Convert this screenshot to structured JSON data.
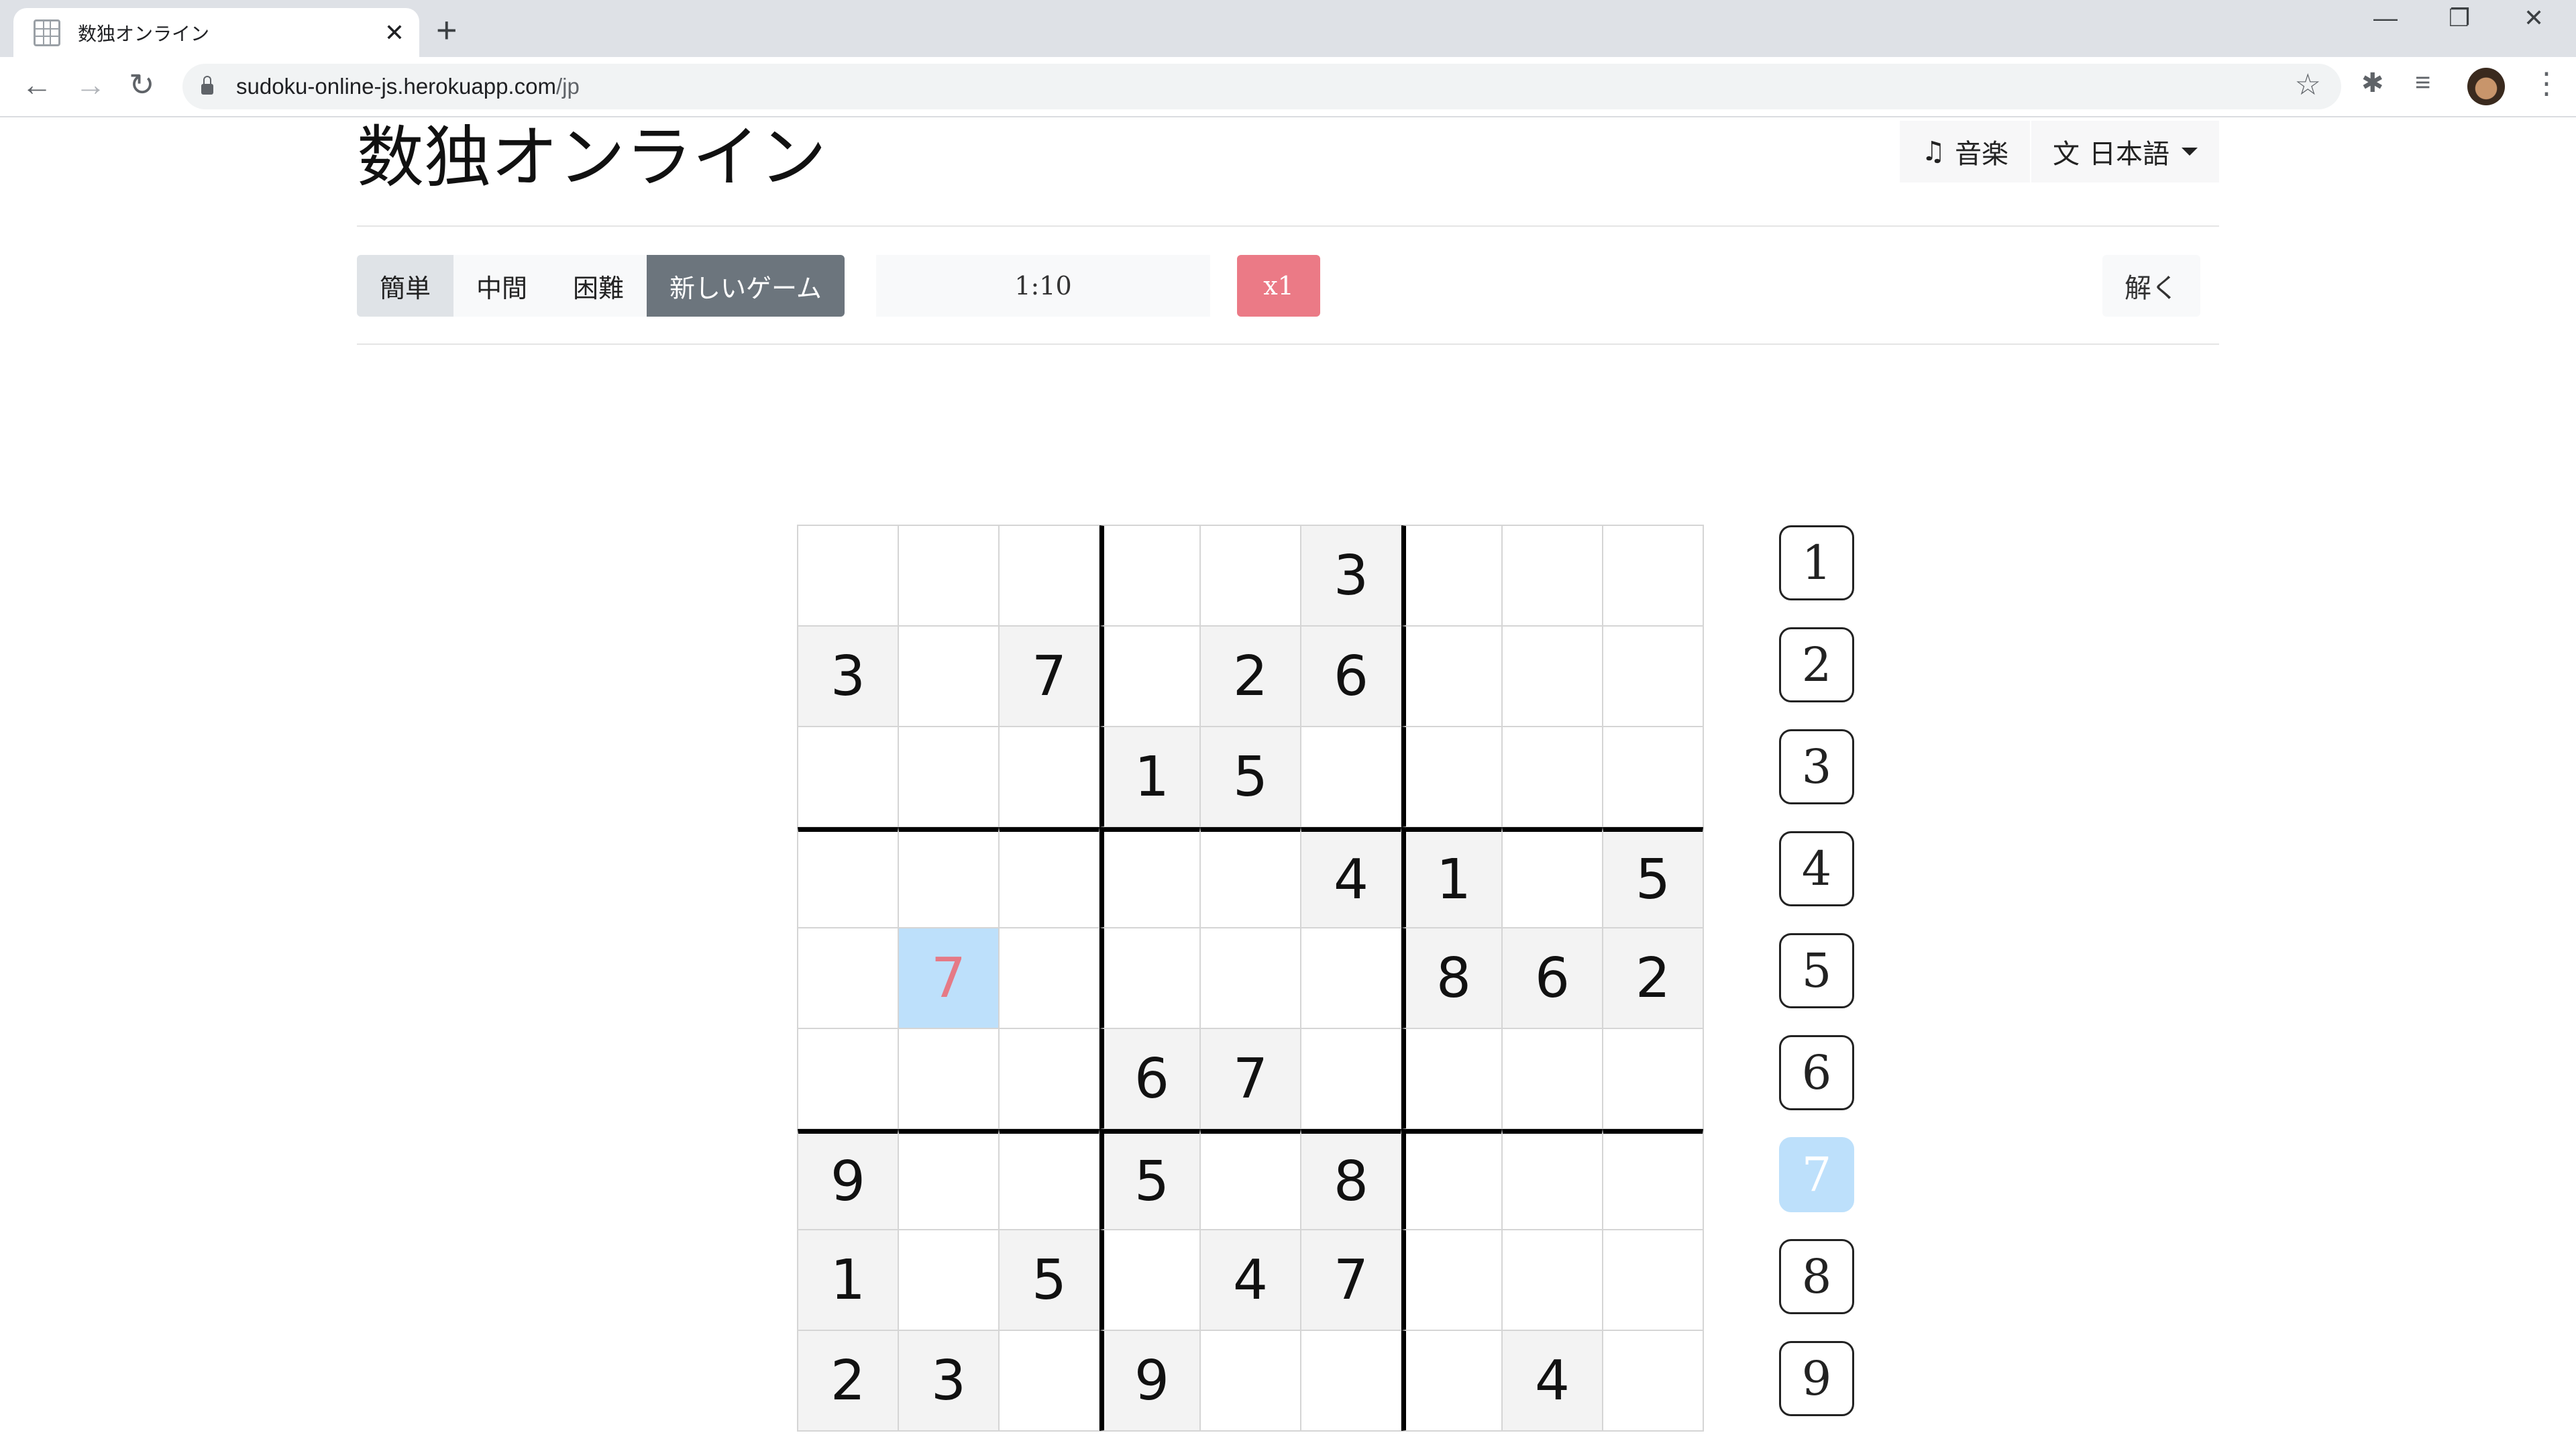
{
  "browser": {
    "tab_title": "数独オンライン",
    "new_tab": "+",
    "close_tab": "✕",
    "url_host": "sudoku-online-js.herokuapp.com",
    "url_path": "/jp",
    "window_controls": {
      "minimize": "—",
      "restore": "❐",
      "close": "✕"
    }
  },
  "header": {
    "title": "数独オンライン",
    "music_label": "音楽",
    "language_label": "日本語"
  },
  "controls": {
    "difficulties": [
      "簡単",
      "中間",
      "困難"
    ],
    "active_difficulty": "簡単",
    "new_game": "新しいゲーム",
    "timer": "1:10",
    "hint": "x1",
    "solve": "解く"
  },
  "board": [
    [
      "",
      "",
      "",
      "",
      "",
      "3",
      "",
      "",
      ""
    ],
    [
      "3",
      "",
      "7",
      "",
      "2",
      "6",
      "",
      "",
      ""
    ],
    [
      "",
      "",
      "",
      "1",
      "5",
      "",
      "",
      "",
      ""
    ],
    [
      "",
      "",
      "",
      "",
      "",
      "4",
      "1",
      "",
      "5"
    ],
    [
      "",
      "7",
      "",
      "",
      "",
      "",
      "8",
      "6",
      "2"
    ],
    [
      "",
      "",
      "",
      "6",
      "7",
      "",
      "",
      "",
      ""
    ],
    [
      "9",
      "",
      "",
      "5",
      "",
      "8",
      "",
      "",
      ""
    ],
    [
      "1",
      "",
      "5",
      "",
      "4",
      "7",
      "",
      "",
      ""
    ],
    [
      "2",
      "3",
      "",
      "9",
      "",
      "",
      "",
      "4",
      ""
    ]
  ],
  "selected_cell": {
    "row": 5,
    "col": 2
  },
  "numpad": [
    "1",
    "2",
    "3",
    "4",
    "5",
    "6",
    "7",
    "8",
    "9"
  ],
  "active_number": "7",
  "colors": {
    "selected_bg": "#bde0fb",
    "selected_text": "#e57a86",
    "given_bg": "#f3f3f3",
    "hint_bg": "#eb7a86",
    "new_game_bg": "#6c757d"
  }
}
